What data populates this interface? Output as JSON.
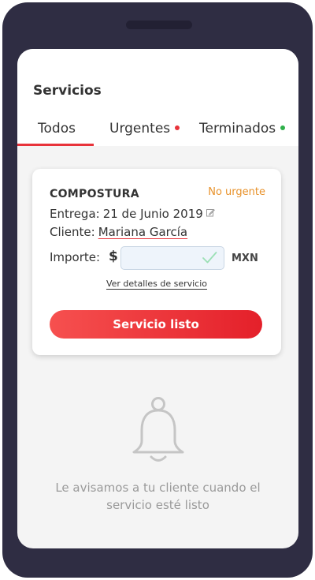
{
  "header": {
    "title": "Servicios"
  },
  "tabs": [
    {
      "label": "Todos"
    },
    {
      "label": "Urgentes"
    },
    {
      "label": "Terminados"
    }
  ],
  "card": {
    "title": "COMPOSTURA",
    "priority": "No urgente",
    "entrega_label": "Entrega:",
    "entrega_value": "21 de Junio 2019",
    "cliente_label": "Cliente:",
    "cliente_value": "Mariana García",
    "importe_label": "Importe:",
    "currency_symbol": "$",
    "amount_value": "",
    "currency_unit": "MXN",
    "details_link": "Ver detalles de servicio",
    "ready_button": "Servicio listo"
  },
  "empty_state": {
    "message": "Le avisamos a tu cliente cuando el servicio esté listo"
  },
  "colors": {
    "frame": "#2f2d43",
    "accent": "#e8333a",
    "warning": "#e8922b",
    "success": "#2fb04a"
  },
  "icons": [
    "edit-icon",
    "check-icon",
    "bell-icon"
  ]
}
